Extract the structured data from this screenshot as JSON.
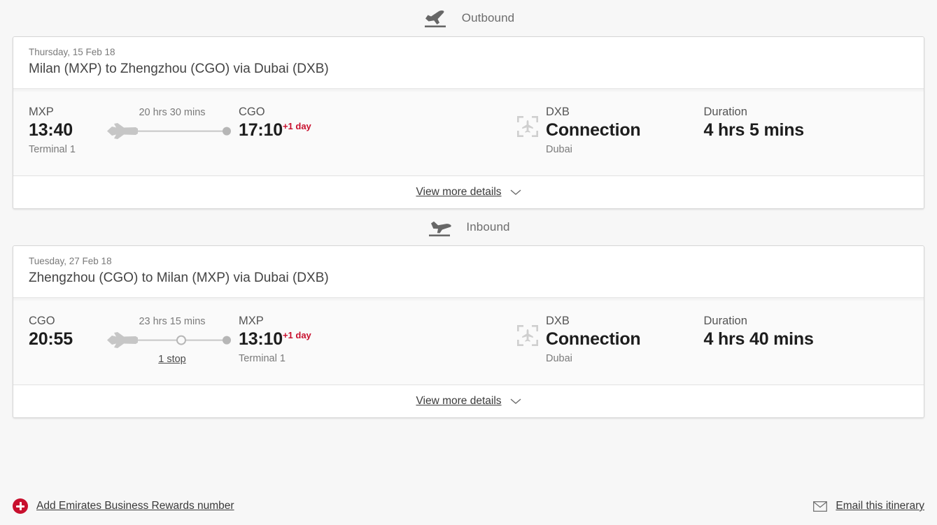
{
  "colors": {
    "page_bg": "#f7f7f7",
    "card_bg": "#fafafa",
    "card_header_bg": "#ffffff",
    "accent_red": "#c8102e",
    "text_primary": "#1d1d1d",
    "text_muted": "#7a7a7a",
    "border": "#d6d6d6"
  },
  "sections": [
    {
      "heading": {
        "label": "Outbound",
        "icon": "plane-takeoff-icon"
      },
      "card": {
        "date": "Thursday, 15 Feb 18",
        "route": "Milan (MXP) to Zhengzhou (CGO) via Dubai (DXB)",
        "departure": {
          "code": "MXP",
          "time": "13:40",
          "day_offset": "",
          "terminal": "Terminal 1"
        },
        "journey": {
          "duration": "20 hrs 30 mins",
          "stops_label": "",
          "has_stop_marker": false
        },
        "arrival": {
          "code": "CGO",
          "time": "17:10",
          "day_offset": "+1 day",
          "terminal": ""
        },
        "connection": {
          "code": "DXB",
          "title": "Connection",
          "city": "Dubai",
          "icon": "flight-transfer-icon"
        },
        "duration": {
          "label": "Duration",
          "value": "4 hrs 5 mins"
        },
        "footer": {
          "label": "View more details",
          "icon": "chevron-down-icon"
        }
      }
    },
    {
      "heading": {
        "label": "Inbound",
        "icon": "plane-landing-icon"
      },
      "card": {
        "date": "Tuesday, 27 Feb 18",
        "route": "Zhengzhou (CGO) to Milan (MXP) via Dubai (DXB)",
        "departure": {
          "code": "CGO",
          "time": "20:55",
          "day_offset": "",
          "terminal": ""
        },
        "journey": {
          "duration": "23 hrs 15 mins",
          "stops_label": "1 stop",
          "has_stop_marker": true
        },
        "arrival": {
          "code": "MXP",
          "time": "13:10",
          "day_offset": "+1 day",
          "terminal": "Terminal 1"
        },
        "connection": {
          "code": "DXB",
          "title": "Connection",
          "city": "Dubai",
          "icon": "flight-transfer-icon"
        },
        "duration": {
          "label": "Duration",
          "value": "4 hrs 40 mins"
        },
        "footer": {
          "label": "View more details",
          "icon": "chevron-down-icon"
        }
      }
    }
  ],
  "bottom_bar": {
    "add_rewards": {
      "label": "Add Emirates Business Rewards number",
      "icon": "plus-circle-icon"
    },
    "email_itinerary": {
      "label": "Email this itinerary",
      "icon": "envelope-icon"
    }
  }
}
